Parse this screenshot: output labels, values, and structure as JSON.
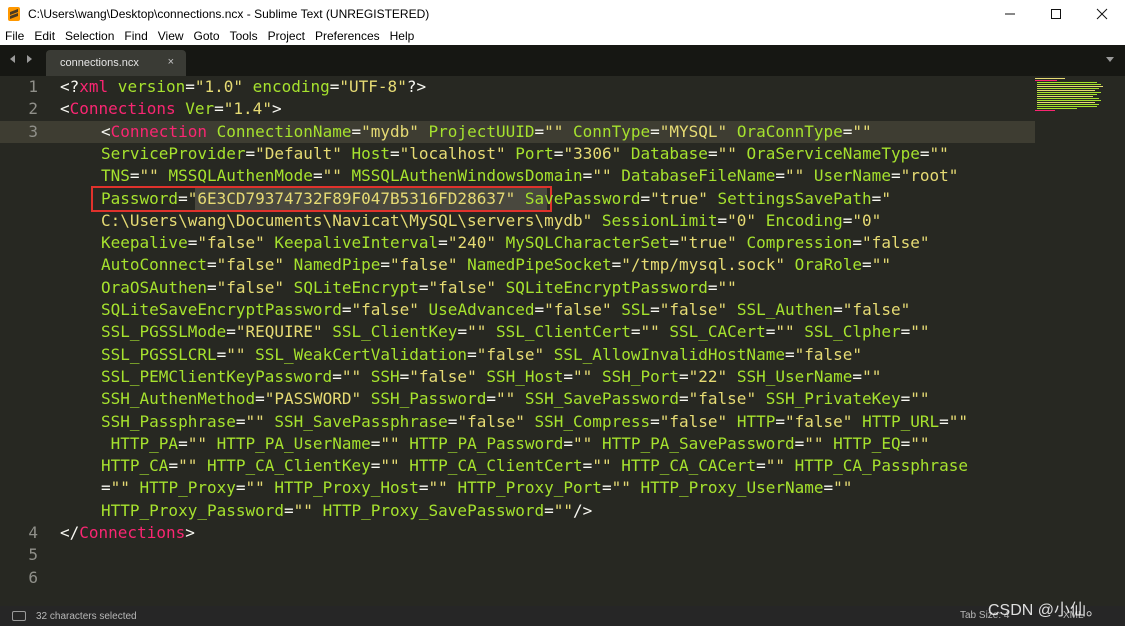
{
  "window": {
    "title": "C:\\Users\\wang\\Desktop\\connections.ncx - Sublime Text (UNREGISTERED)",
    "minimize": "—",
    "maximize": "☐",
    "close": "✕"
  },
  "menu": [
    "File",
    "Edit",
    "Selection",
    "Find",
    "View",
    "Goto",
    "Tools",
    "Project",
    "Preferences",
    "Help"
  ],
  "tab": {
    "name": "connections.ncx",
    "close": "×"
  },
  "line_numbers": [
    "1",
    "2",
    "3",
    "",
    "",
    "",
    "",
    "",
    "",
    "",
    "",
    "",
    "",
    "",
    "",
    "",
    "",
    "",
    "",
    "",
    "4",
    "5",
    "6"
  ],
  "status": {
    "selection": "32 characters selected",
    "tab_size": "Tab Size: 4",
    "syntax": "XML"
  },
  "watermark": "CSDN @小仙。",
  "colors": {
    "background": "#272822",
    "tag": "#f92672",
    "attribute": "#a6e22e",
    "string": "#e6db74",
    "text": "#f8f8f2",
    "highlight_box": "#e0322c"
  },
  "code": {
    "l1": {
      "open": "<?",
      "tag": "xml",
      "a1": " version",
      "eq1": "=",
      "v1": "\"1.0\"",
      "a2": " encoding",
      "eq2": "=",
      "v2": "\"UTF-8\"",
      "close": "?>"
    },
    "l2": {
      "open": "<",
      "tag": "Connections",
      "a1": " Ver",
      "eq1": "=",
      "v1": "\"1.4\"",
      "close": ">"
    },
    "l3": {
      "open": "<",
      "tag": "Connection",
      "a1": " ConnectionName",
      "v1": "\"mydb\"",
      "a2": " ProjectUUID",
      "v2": "\"\"",
      "a3": " ConnType",
      "v3": "\"MYSQL\"",
      "a4": " OraConnType",
      "v4": "\"\""
    },
    "l3b": {
      "a1": "ServiceProvider",
      "v1": "\"Default\"",
      "a2": " Host",
      "v2": "\"localhost\"",
      "a3": " Port",
      "v3": "\"3306\"",
      "a4": " Database",
      "v4": "\"\"",
      "a5": " OraServiceNameType",
      "v5": "\"\""
    },
    "l3c": {
      "a1": "TNS",
      "v1": "\"\"",
      "a2": " MSSQLAuthenMode",
      "v2": "\"\"",
      "a3": " MSSQLAuthenWindowsDomain",
      "v3": "\"\"",
      "a4": " DatabaseFileName",
      "v4": "\"\"",
      "a5": " UserName",
      "v5": "\"root\""
    },
    "l3d": {
      "a1": "Password",
      "v1q": "\"",
      "v1": "6E3CD79374732F89F047B5316FD28637",
      "v1e": "\"",
      "a2": " SavePassword",
      "v2": "\"true\"",
      "a3": " SettingsSavePath",
      "v3": "\""
    },
    "l3e": {
      "p1": "C:\\Users\\wang\\Documents\\Navicat\\MySQL\\servers\\mydb",
      "a1": " SessionLimit",
      "v1": "\"0\"",
      "a2": " Encoding",
      "v2": "\"0\""
    },
    "l3f": {
      "a1": "Keepalive",
      "v1": "\"false\"",
      "a2": " KeepaliveInterval",
      "v2": "\"240\"",
      "a3": " MySQLCharacterSet",
      "v3": "\"true\"",
      "a4": " Compression",
      "v4": "\"false\""
    },
    "l3g": {
      "a1": "AutoConnect",
      "v1": "\"false\"",
      "a2": " NamedPipe",
      "v2": "\"false\"",
      "a3": " NamedPipeSocket",
      "v3": "\"/tmp/mysql.sock\"",
      "a4": " OraRole",
      "v4": "\"\""
    },
    "l3h": {
      "a1": "OraOSAuthen",
      "v1": "\"false\"",
      "a2": " SQLiteEncrypt",
      "v2": "\"false\"",
      "a3": " SQLiteEncryptPassword",
      "v3": "\"\""
    },
    "l3i": {
      "a1": "SQLiteSaveEncryptPassword",
      "v1": "\"false\"",
      "a2": " UseAdvanced",
      "v2": "\"false\"",
      "a3": " SSL",
      "v3": "\"false\"",
      "a4": " SSL_Authen",
      "v4": "\"false\""
    },
    "l3j": {
      "a1": "SSL_PGSSLMode",
      "v1": "\"REQUIRE\"",
      "a2": " SSL_ClientKey",
      "v2": "\"\"",
      "a3": " SSL_ClientCert",
      "v3": "\"\"",
      "a4": " SSL_CACert",
      "v4": "\"\"",
      "a5": " SSL_Clpher",
      "v5": "\"\""
    },
    "l3k": {
      "a1": "SSL_PGSSLCRL",
      "v1": "\"\"",
      "a2": " SSL_WeakCertValidation",
      "v2": "\"false\"",
      "a3": " SSL_AllowInvalidHostName",
      "v3": "\"false\""
    },
    "l3l": {
      "a1": "SSL_PEMClientKeyPassword",
      "v1": "\"\"",
      "a2": " SSH",
      "v2": "\"false\"",
      "a3": " SSH_Host",
      "v3": "\"\"",
      "a4": " SSH_Port",
      "v4": "\"22\"",
      "a5": " SSH_UserName",
      "v5": "\"\""
    },
    "l3m": {
      "a1": "SSH_AuthenMethod",
      "v1": "\"PASSWORD\"",
      "a2": " SSH_Password",
      "v2": "\"\"",
      "a3": " SSH_SavePassword",
      "v3": "\"false\"",
      "a4": " SSH_PrivateKey",
      "v4": "\"\""
    },
    "l3n": {
      "a1": "SSH_Passphrase",
      "v1": "\"\"",
      "a2": " SSH_SavePassphrase",
      "v2": "\"false\"",
      "a3": " SSH_Compress",
      "v3": "\"false\"",
      "a4": " HTTP",
      "v4": "\"false\"",
      "a5": " HTTP_URL",
      "v5": "\"\""
    },
    "l3o": {
      "a1": " HTTP_PA",
      "v1": "\"\"",
      "a2": " HTTP_PA_UserName",
      "v2": "\"\"",
      "a3": " HTTP_PA_Password",
      "v3": "\"\"",
      "a4": " HTTP_PA_SavePassword",
      "v4": "\"\"",
      "a5": " HTTP_EQ",
      "v5": "\"\""
    },
    "l3p": {
      "a1": "HTTP_CA",
      "v1": "\"\"",
      "a2": " HTTP_CA_ClientKey",
      "v2": "\"\"",
      "a3": " HTTP_CA_ClientCert",
      "v3": "\"\"",
      "a4": " HTTP_CA_CACert",
      "v4": "\"\"",
      "a5": " HTTP_CA_Passphrase"
    },
    "l3q": {
      "v0": "\"\"",
      "a1": " HTTP_Proxy",
      "v1": "\"\"",
      "a2": " HTTP_Proxy_Host",
      "v2": "\"\"",
      "a3": " HTTP_Proxy_Port",
      "v3": "\"\"",
      "a4": " HTTP_Proxy_UserName",
      "v4": "\"\""
    },
    "l3r": {
      "a1": "HTTP_Proxy_Password",
      "v1": "\"\"",
      "a2": " HTTP_Proxy_SavePassword",
      "v2": "\"\"",
      "close": "/>"
    },
    "l4": {
      "open": "</",
      "tag": "Connections",
      "close": ">"
    }
  }
}
